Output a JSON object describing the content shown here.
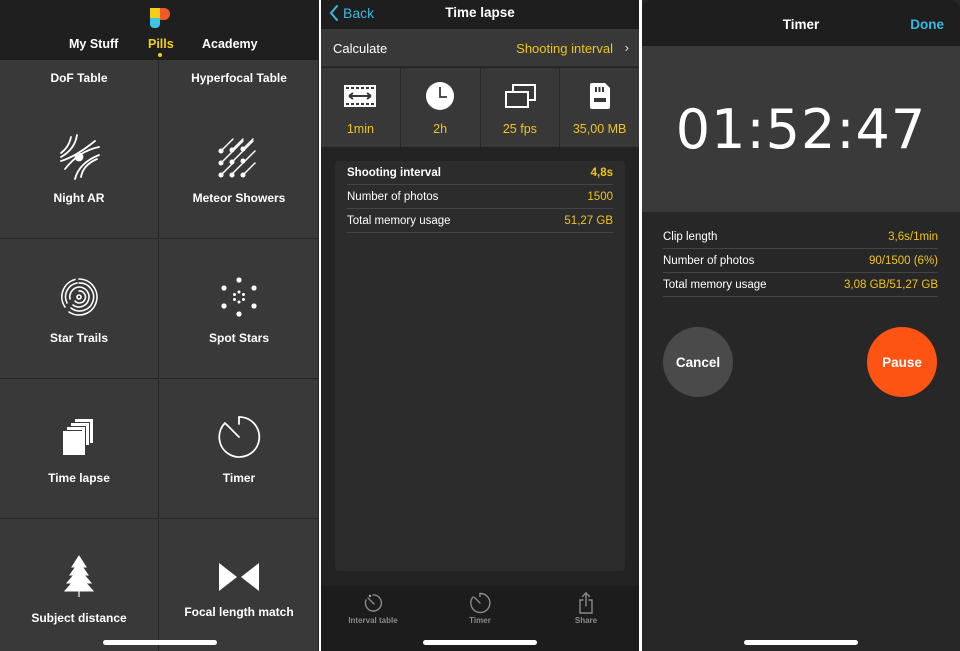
{
  "panel_pills": {
    "logo": "app-logo",
    "tabs": [
      {
        "label": "My Stuff",
        "active": false
      },
      {
        "label": "Pills",
        "active": true
      },
      {
        "label": "Academy",
        "active": false
      }
    ],
    "tiles": [
      {
        "label": "DoF Table",
        "icon": "dof-table-icon",
        "partial": true
      },
      {
        "label": "Hyperfocal Table",
        "icon": "hyperfocal-table-icon",
        "partial": true
      },
      {
        "label": "Night AR",
        "icon": "night-ar-icon"
      },
      {
        "label": "Meteor Showers",
        "icon": "meteor-showers-icon"
      },
      {
        "label": "Star Trails",
        "icon": "star-trails-icon"
      },
      {
        "label": "Spot Stars",
        "icon": "spot-stars-icon"
      },
      {
        "label": "Time lapse",
        "icon": "time-lapse-icon"
      },
      {
        "label": "Timer",
        "icon": "timer-icon"
      },
      {
        "label": "Subject distance",
        "icon": "tree-icon"
      },
      {
        "label": "Focal length match",
        "icon": "bowtie-icon"
      }
    ]
  },
  "panel_timelapse": {
    "back_label": "Back",
    "title": "Time lapse",
    "calculate_label": "Calculate",
    "calculate_value": "Shooting interval",
    "params": [
      {
        "icon": "film-length-icon",
        "value": "1min"
      },
      {
        "icon": "clock-icon",
        "value": "2h"
      },
      {
        "icon": "frames-icon",
        "value": "25 fps"
      },
      {
        "icon": "sd-card-icon",
        "value": "35,00 MB"
      }
    ],
    "results": [
      {
        "label": "Shooting interval",
        "value": "4,8s",
        "bold": true
      },
      {
        "label": "Number of photos",
        "value": "1500"
      },
      {
        "label": "Total memory usage",
        "value": "51,27 GB"
      }
    ],
    "tabbar": [
      {
        "label": "Interval table",
        "icon": "interval-table-icon"
      },
      {
        "label": "Timer",
        "icon": "timer-icon"
      },
      {
        "label": "Share",
        "icon": "share-icon"
      }
    ]
  },
  "panel_timer": {
    "title": "Timer",
    "done_label": "Done",
    "clock": "01:52:47",
    "results": [
      {
        "label": "Clip length",
        "value": "3,6s/1min"
      },
      {
        "label": "Number of photos",
        "value": "90/1500 (6%)"
      },
      {
        "label": "Total memory usage",
        "value": "3,08 GB/51,27 GB"
      }
    ],
    "cancel_label": "Cancel",
    "pause_label": "Pause"
  },
  "colors": {
    "accent_yellow": "#f0c419",
    "link_blue": "#39b9df",
    "pause_orange": "#fd5413"
  }
}
